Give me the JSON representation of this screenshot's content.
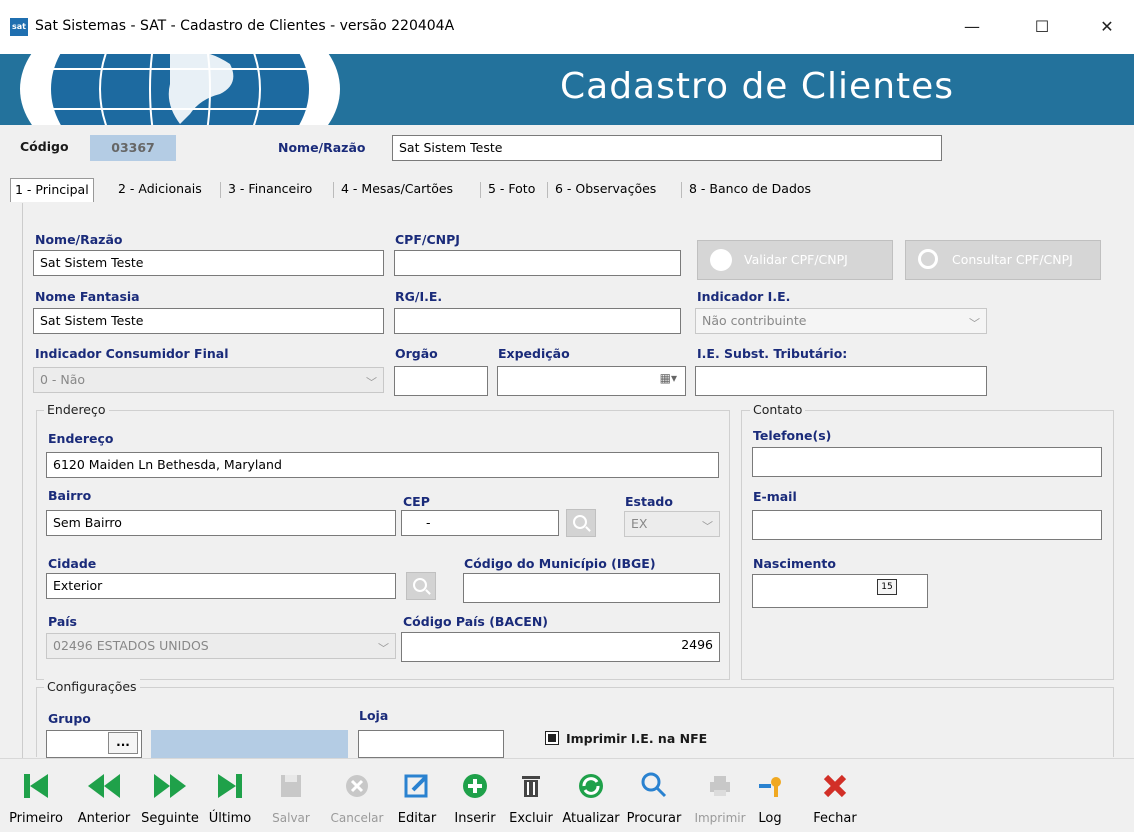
{
  "window": {
    "title": "Sat Sistemas - SAT - Cadastro de Clientes - versão 220404A",
    "icon_text": "sat",
    "minimize_label": "—",
    "maximize_label": "☐",
    "close_label": "✕"
  },
  "banner": {
    "title": "Cadastro de Clientes"
  },
  "header": {
    "codigo_label": "Código",
    "codigo_value": "03367",
    "nome_label": "Nome/Razão",
    "nome_value": "Sat Sistem Teste"
  },
  "tabs": [
    {
      "label": "1 - Principal"
    },
    {
      "label": "2 - Adicionais"
    },
    {
      "label": "3 - Financeiro"
    },
    {
      "label": "4 - Mesas/Cartões"
    },
    {
      "label": "5 - Foto"
    },
    {
      "label": "6 - Observações"
    },
    {
      "label": "8 - Banco de Dados"
    }
  ],
  "main": {
    "nome_razao_label": "Nome/Razão",
    "nome_razao_value": "Sat Sistem Teste",
    "cpf_label": "CPF/CNPJ",
    "cpf_value": "",
    "validar_label": "Validar CPF/CNPJ",
    "consultar_label": "Consultar CPF/CNPJ",
    "fantasia_label": "Nome Fantasia",
    "fantasia_value": "Sat Sistem Teste",
    "rg_label": "RG/I.E.",
    "rg_value": "",
    "indicador_ie_label": "Indicador I.E.",
    "indicador_ie_value": "Não contribuinte",
    "consumidor_label": "Indicador Consumidor Final",
    "consumidor_value": "0 - Não",
    "orgao_label": "Orgão",
    "orgao_value": "",
    "expedicao_label": "Expedição",
    "expedicao_value": "",
    "ie_subst_label": "I.E. Subst. Tributário:",
    "ie_subst_value": ""
  },
  "endereco": {
    "group_label": "Endereço",
    "endereco_label": "Endereço",
    "endereco_value": "6120 Maiden Ln Bethesda, Maryland",
    "bairro_label": "Bairro",
    "bairro_value": "Sem Bairro",
    "cep_label": "CEP",
    "cep_value": "-",
    "estado_label": "Estado",
    "estado_value": "EX",
    "cidade_label": "Cidade",
    "cidade_value": "Exterior",
    "municipio_label": "Código do Município (IBGE)",
    "municipio_value": "",
    "pais_label": "País",
    "pais_value": "02496 ESTADOS UNIDOS",
    "codigo_pais_label": "Código País (BACEN)",
    "codigo_pais_value": "2496"
  },
  "contato": {
    "group_label": "Contato",
    "telefone_label": "Telefone(s)",
    "telefone_value": "",
    "email_label": "E-mail",
    "email_value": "",
    "nascimento_label": "Nascimento",
    "nascimento_value": "",
    "cal_text": "15"
  },
  "config": {
    "group_label": "Configurações",
    "grupo_label": "Grupo",
    "grupo_btn": "...",
    "loja_label": "Loja",
    "imprimir_ie_label": "Imprimir I.E. na NFE"
  },
  "toolbar": {
    "items": [
      {
        "label": "Primeiro",
        "icon": "first-record-icon",
        "enabled": true
      },
      {
        "label": "Anterior",
        "icon": "previous-record-icon",
        "enabled": true
      },
      {
        "label": "Seguinte",
        "icon": "next-record-icon",
        "enabled": true
      },
      {
        "label": "Último",
        "icon": "last-record-icon",
        "enabled": true
      },
      {
        "label": "Salvar",
        "icon": "save-icon",
        "enabled": false
      },
      {
        "label": "Cancelar",
        "icon": "cancel-icon",
        "enabled": false
      },
      {
        "label": "Editar",
        "icon": "edit-icon",
        "enabled": true
      },
      {
        "label": "Inserir",
        "icon": "insert-icon",
        "enabled": true
      },
      {
        "label": "Excluir",
        "icon": "delete-icon",
        "enabled": true
      },
      {
        "label": "Atualizar",
        "icon": "refresh-icon",
        "enabled": true
      },
      {
        "label": "Procurar",
        "icon": "search-icon",
        "enabled": true
      },
      {
        "label": "Imprimir",
        "icon": "print-icon",
        "enabled": false
      },
      {
        "label": "Log",
        "icon": "log-key-icon",
        "enabled": true
      },
      {
        "label": "Fechar",
        "icon": "close-icon",
        "enabled": true
      }
    ]
  },
  "colors": {
    "banner": "#23729c",
    "label_blue": "#1a2b7a",
    "nav_green": "#1fa14a",
    "close_red": "#d22f27"
  }
}
